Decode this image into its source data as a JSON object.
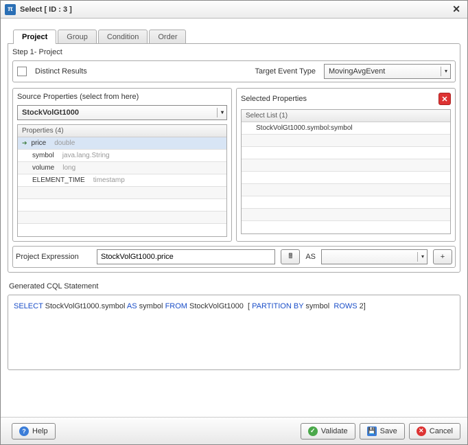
{
  "title": "Select [ ID : 3 ]",
  "tabs": [
    "Project",
    "Group",
    "Condition",
    "Order"
  ],
  "step_title": "Step 1- Project",
  "distinct_label": "Distinct Results",
  "target_event_label": "Target Event Type",
  "target_event_value": "MovingAvgEvent",
  "source_panel_title": "Source Properties (select from here)",
  "source_select_value": "StockVolGt1000",
  "properties_header": "Properties (4)",
  "properties": [
    {
      "name": "price",
      "type": "double",
      "selected": true
    },
    {
      "name": "symbol",
      "type": "java.lang.String",
      "selected": false
    },
    {
      "name": "volume",
      "type": "long",
      "selected": false
    },
    {
      "name": "ELEMENT_TIME",
      "type": "timestamp",
      "selected": false
    }
  ],
  "selected_panel_title": "Selected Properties",
  "select_list_header": "Select List (1)",
  "select_list_items": [
    "StockVolGt1000.symbol:symbol"
  ],
  "project_expr_label": "Project Expression",
  "project_expr_value": "StockVolGt1000.price",
  "as_label": "AS",
  "as_value": "",
  "add_label": "+",
  "cql_header": "Generated CQL Statement",
  "cql": {
    "select": "SELECT",
    "expr": "StockVolGt1000.symbol",
    "as": "AS",
    "alias": "symbol",
    "from": "FROM",
    "source": "StockVolGt1000",
    "open_br": "[",
    "partition": "PARTITION BY",
    "partcol": "symbol",
    "rows": "ROWS",
    "rowsn": "2]"
  },
  "buttons": {
    "help": "Help",
    "validate": "Validate",
    "save": "Save",
    "cancel": "Cancel"
  }
}
